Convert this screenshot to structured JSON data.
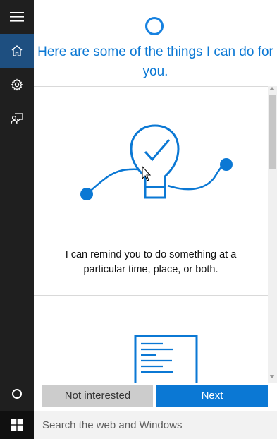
{
  "header": {
    "title": "Here are some of the things I can do for you."
  },
  "rail": {
    "items": [
      {
        "icon": "hamburger-icon"
      },
      {
        "icon": "home-icon",
        "active": true
      },
      {
        "icon": "gear-icon"
      },
      {
        "icon": "feedback-icon"
      },
      {
        "icon": "cortana-circle-icon"
      }
    ]
  },
  "cards": [
    {
      "icon": "lightbulb-check-icon",
      "text": "I can remind you to do something at a particular time, place, or both."
    },
    {
      "icon": "document-icon"
    }
  ],
  "buttons": {
    "not_interested": "Not interested",
    "next": "Next"
  },
  "taskbar": {
    "search_placeholder": "Search the web and Windows"
  },
  "colors": {
    "accent": "#0b78d4",
    "rail_bg": "#1f1f1f",
    "rail_active": "#1e4f80"
  }
}
